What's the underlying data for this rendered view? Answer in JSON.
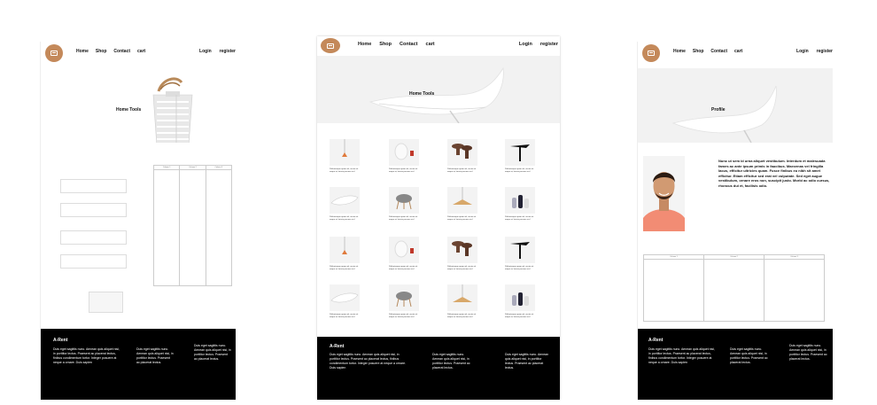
{
  "nav": {
    "links": [
      "Home",
      "Shop",
      "Contact",
      "cart"
    ],
    "login": "Login",
    "register": "register"
  },
  "login_page": {
    "hero_title": "Home Tools",
    "table_headers": [
      "Column 1",
      "Column 2",
      "Column 3"
    ]
  },
  "shop_page": {
    "hero_title": "Home Tools",
    "product_caption": "Pellentesque quam vel, auctor sit neque at, lacinia posuere nisl"
  },
  "profile_page": {
    "hero_title": "Profile",
    "bio": "Nunc ut sem id urna aliquet vestibulum. Interdum et malesuada fames ac ante ipsum primis in faucibus. Maecenas vel fringilla lacus, efficitur ultricies quam. Fusce finibus eu nibh sit amet efficitur. Etiam efficitur sed erat vel vulputate. Sed eget augue vestibulum, ornare eros non, suscipit justo. Morbi ac odio cursus, rhoncus dui et, facilisis odio.",
    "table_headers": [
      "Column 1",
      "Column 2",
      "Column 3"
    ]
  },
  "footer": {
    "brand": "A-Rent",
    "col1": "Duis eget sagittis nunc. Aenean quis aliquet nisi, in porttitor lectus. Praesent ac placerat lectus, finibus condimentum tortor. Integer posuere at neque a ornare. Duis sapien",
    "col2": "Duis eget sagittis nunc. Aenean quis aliquet nisi, in porttitor lectus. Praesent ac placerat lectus.",
    "col3": "Duis eget sagittis nunc. Aenean quis aliquet nisi, in porttitor lectus. Praesent ac placerat lectus."
  },
  "colors": {
    "logo": "#c4895a",
    "footer": "#000000"
  }
}
